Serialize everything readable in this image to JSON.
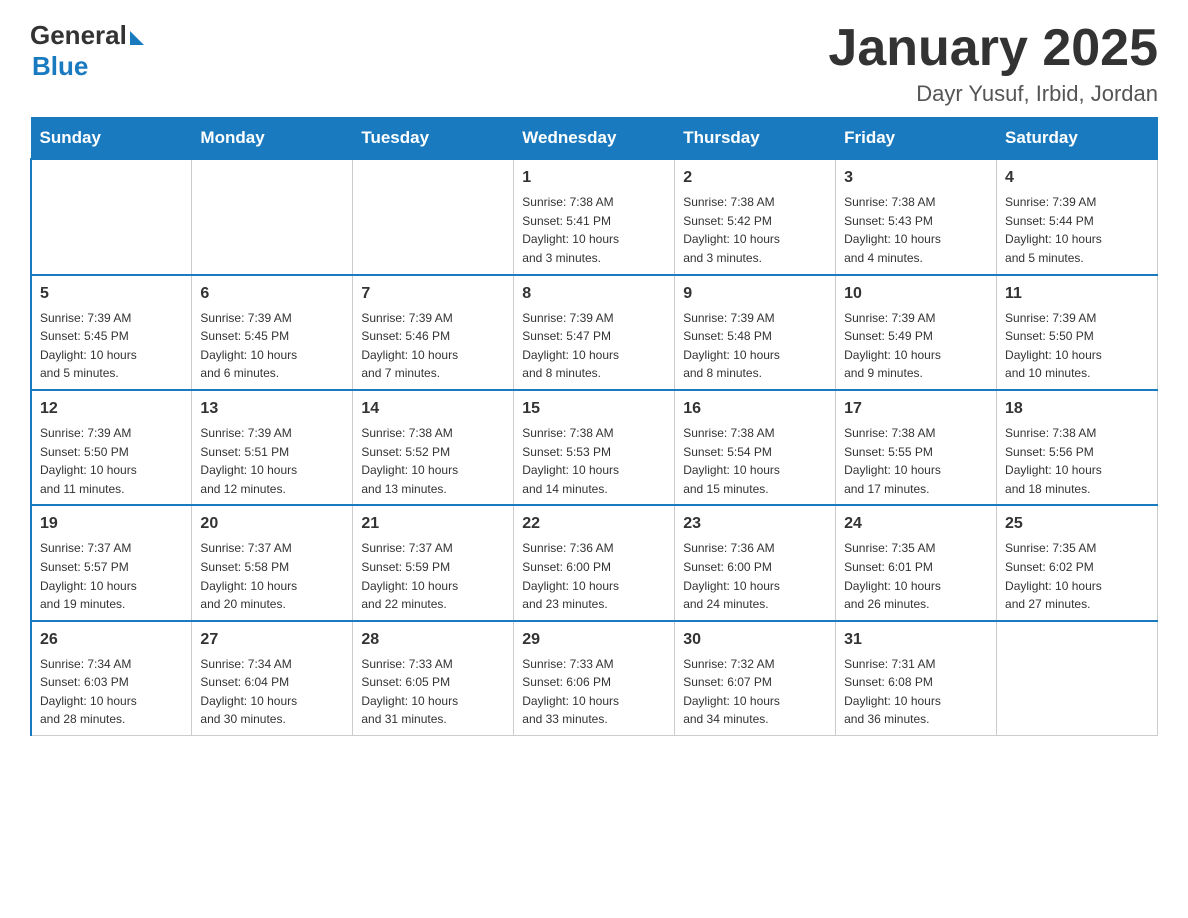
{
  "logo": {
    "general": "General",
    "blue": "Blue"
  },
  "title": "January 2025",
  "subtitle": "Dayr Yusuf, Irbid, Jordan",
  "headers": [
    "Sunday",
    "Monday",
    "Tuesday",
    "Wednesday",
    "Thursday",
    "Friday",
    "Saturday"
  ],
  "weeks": [
    [
      {
        "day": "",
        "info": ""
      },
      {
        "day": "",
        "info": ""
      },
      {
        "day": "",
        "info": ""
      },
      {
        "day": "1",
        "info": "Sunrise: 7:38 AM\nSunset: 5:41 PM\nDaylight: 10 hours\nand 3 minutes."
      },
      {
        "day": "2",
        "info": "Sunrise: 7:38 AM\nSunset: 5:42 PM\nDaylight: 10 hours\nand 3 minutes."
      },
      {
        "day": "3",
        "info": "Sunrise: 7:38 AM\nSunset: 5:43 PM\nDaylight: 10 hours\nand 4 minutes."
      },
      {
        "day": "4",
        "info": "Sunrise: 7:39 AM\nSunset: 5:44 PM\nDaylight: 10 hours\nand 5 minutes."
      }
    ],
    [
      {
        "day": "5",
        "info": "Sunrise: 7:39 AM\nSunset: 5:45 PM\nDaylight: 10 hours\nand 5 minutes."
      },
      {
        "day": "6",
        "info": "Sunrise: 7:39 AM\nSunset: 5:45 PM\nDaylight: 10 hours\nand 6 minutes."
      },
      {
        "day": "7",
        "info": "Sunrise: 7:39 AM\nSunset: 5:46 PM\nDaylight: 10 hours\nand 7 minutes."
      },
      {
        "day": "8",
        "info": "Sunrise: 7:39 AM\nSunset: 5:47 PM\nDaylight: 10 hours\nand 8 minutes."
      },
      {
        "day": "9",
        "info": "Sunrise: 7:39 AM\nSunset: 5:48 PM\nDaylight: 10 hours\nand 8 minutes."
      },
      {
        "day": "10",
        "info": "Sunrise: 7:39 AM\nSunset: 5:49 PM\nDaylight: 10 hours\nand 9 minutes."
      },
      {
        "day": "11",
        "info": "Sunrise: 7:39 AM\nSunset: 5:50 PM\nDaylight: 10 hours\nand 10 minutes."
      }
    ],
    [
      {
        "day": "12",
        "info": "Sunrise: 7:39 AM\nSunset: 5:50 PM\nDaylight: 10 hours\nand 11 minutes."
      },
      {
        "day": "13",
        "info": "Sunrise: 7:39 AM\nSunset: 5:51 PM\nDaylight: 10 hours\nand 12 minutes."
      },
      {
        "day": "14",
        "info": "Sunrise: 7:38 AM\nSunset: 5:52 PM\nDaylight: 10 hours\nand 13 minutes."
      },
      {
        "day": "15",
        "info": "Sunrise: 7:38 AM\nSunset: 5:53 PM\nDaylight: 10 hours\nand 14 minutes."
      },
      {
        "day": "16",
        "info": "Sunrise: 7:38 AM\nSunset: 5:54 PM\nDaylight: 10 hours\nand 15 minutes."
      },
      {
        "day": "17",
        "info": "Sunrise: 7:38 AM\nSunset: 5:55 PM\nDaylight: 10 hours\nand 17 minutes."
      },
      {
        "day": "18",
        "info": "Sunrise: 7:38 AM\nSunset: 5:56 PM\nDaylight: 10 hours\nand 18 minutes."
      }
    ],
    [
      {
        "day": "19",
        "info": "Sunrise: 7:37 AM\nSunset: 5:57 PM\nDaylight: 10 hours\nand 19 minutes."
      },
      {
        "day": "20",
        "info": "Sunrise: 7:37 AM\nSunset: 5:58 PM\nDaylight: 10 hours\nand 20 minutes."
      },
      {
        "day": "21",
        "info": "Sunrise: 7:37 AM\nSunset: 5:59 PM\nDaylight: 10 hours\nand 22 minutes."
      },
      {
        "day": "22",
        "info": "Sunrise: 7:36 AM\nSunset: 6:00 PM\nDaylight: 10 hours\nand 23 minutes."
      },
      {
        "day": "23",
        "info": "Sunrise: 7:36 AM\nSunset: 6:00 PM\nDaylight: 10 hours\nand 24 minutes."
      },
      {
        "day": "24",
        "info": "Sunrise: 7:35 AM\nSunset: 6:01 PM\nDaylight: 10 hours\nand 26 minutes."
      },
      {
        "day": "25",
        "info": "Sunrise: 7:35 AM\nSunset: 6:02 PM\nDaylight: 10 hours\nand 27 minutes."
      }
    ],
    [
      {
        "day": "26",
        "info": "Sunrise: 7:34 AM\nSunset: 6:03 PM\nDaylight: 10 hours\nand 28 minutes."
      },
      {
        "day": "27",
        "info": "Sunrise: 7:34 AM\nSunset: 6:04 PM\nDaylight: 10 hours\nand 30 minutes."
      },
      {
        "day": "28",
        "info": "Sunrise: 7:33 AM\nSunset: 6:05 PM\nDaylight: 10 hours\nand 31 minutes."
      },
      {
        "day": "29",
        "info": "Sunrise: 7:33 AM\nSunset: 6:06 PM\nDaylight: 10 hours\nand 33 minutes."
      },
      {
        "day": "30",
        "info": "Sunrise: 7:32 AM\nSunset: 6:07 PM\nDaylight: 10 hours\nand 34 minutes."
      },
      {
        "day": "31",
        "info": "Sunrise: 7:31 AM\nSunset: 6:08 PM\nDaylight: 10 hours\nand 36 minutes."
      },
      {
        "day": "",
        "info": ""
      }
    ]
  ]
}
